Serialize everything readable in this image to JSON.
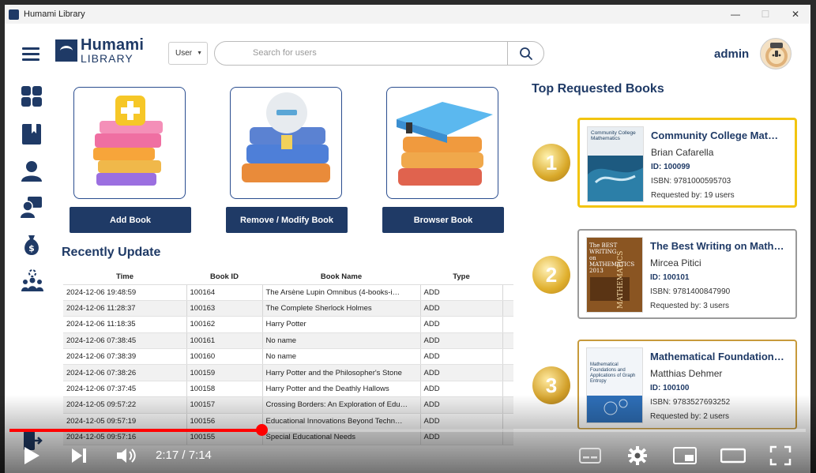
{
  "window": {
    "title": "Humami Library",
    "controls": {
      "minimize": "—",
      "maximize": "☐",
      "close": "✕"
    }
  },
  "header": {
    "brand_top": "Humami",
    "brand_bottom": "LIBRARY",
    "user_type": "User",
    "search_placeholder": "Search for users",
    "admin_name": "admin"
  },
  "sidebar": {
    "items": [
      {
        "icon": "dashboard-icon"
      },
      {
        "icon": "book-icon"
      },
      {
        "icon": "user-icon"
      },
      {
        "icon": "users-icon"
      },
      {
        "icon": "money-bag-icon"
      },
      {
        "icon": "team-settings-icon"
      },
      {
        "icon": "logout-icon"
      }
    ]
  },
  "actions": {
    "add_label": "Add Book",
    "remove_label": "Remove / Modify Book",
    "browse_label": "Browser Book"
  },
  "recent": {
    "title": "Recently Update",
    "columns": [
      "Time",
      "Book ID",
      "Book Name",
      "Type"
    ],
    "rows": [
      [
        "2024-12-06 19:48:59",
        "100164",
        "The Arsène Lupin Omnibus (4-books-i…",
        "ADD"
      ],
      [
        "2024-12-06 11:28:37",
        "100163",
        "The Complete Sherlock Holmes",
        "ADD"
      ],
      [
        "2024-12-06 11:18:35",
        "100162",
        "Harry Potter",
        "ADD"
      ],
      [
        "2024-12-06 07:38:45",
        "100161",
        "No name",
        "ADD"
      ],
      [
        "2024-12-06 07:38:39",
        "100160",
        "No name",
        "ADD"
      ],
      [
        "2024-12-06 07:38:26",
        "100159",
        "Harry Potter and the Philosopher's Stone",
        "ADD"
      ],
      [
        "2024-12-06 07:37:45",
        "100158",
        "Harry Potter and the Deathly Hallows",
        "ADD"
      ],
      [
        "2024-12-05 09:57:22",
        "100157",
        "Crossing Borders: An Exploration of Edu…",
        "ADD"
      ],
      [
        "2024-12-05 09:57:19",
        "100156",
        "Educational Innovations Beyond Techn…",
        "ADD"
      ],
      [
        "2024-12-05 09:57:16",
        "100155",
        "Special Educational Needs",
        "ADD"
      ]
    ]
  },
  "top_requested": {
    "title": "Top Requested Books",
    "books": [
      {
        "rank": "1",
        "title": "Community College Mat…",
        "author": "Brian Cafarella",
        "id": "ID: 100099",
        "isbn": "ISBN: 9781000595703",
        "requested": "Requested by: 19 users",
        "border": "#f2c40f",
        "cover_text": "Community College Mathematics"
      },
      {
        "rank": "2",
        "title": "The Best Writing on Math…",
        "author": "Mircea Pitici",
        "id": "ID: 100101",
        "isbn": "ISBN: 9781400847990",
        "requested": "Requested by: 3 users",
        "border": "#9a9a9a",
        "cover_text": "The BEST WRITING on MATHEMATICS 2013"
      },
      {
        "rank": "3",
        "title": "Mathematical Foundation…",
        "author": "Matthias Dehmer",
        "id": "ID: 100100",
        "isbn": "ISBN: 9783527693252",
        "requested": "Requested by: 2 users",
        "border": "#c79a3b",
        "cover_text": "Mathematical Foundations and Applications of Graph Entropy"
      }
    ]
  },
  "video": {
    "time": "2:17 / 7:14",
    "progress": 0.316
  },
  "colors": {
    "navy": "#1f3a66",
    "accent_red": "#ff0000"
  }
}
